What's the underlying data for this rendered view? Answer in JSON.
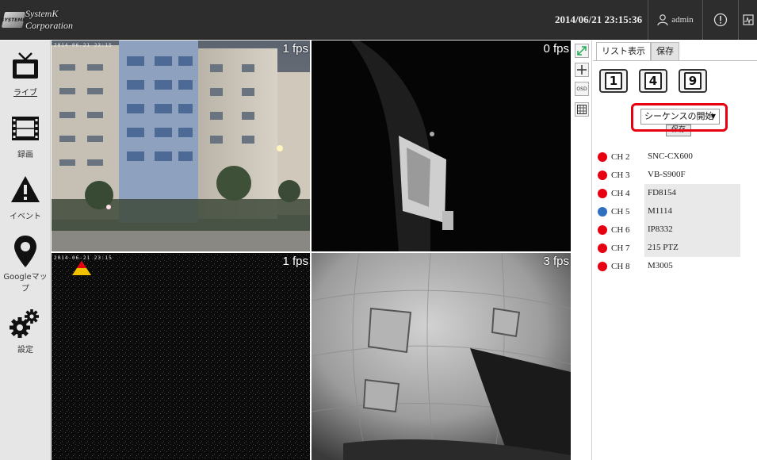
{
  "header": {
    "brand": "SystemK Corporation",
    "logo_mark": "SYSTEMK",
    "datetime": "2014/06/21 23:15:36",
    "user": "admin"
  },
  "sidebar": {
    "items": [
      {
        "label": "ライブ",
        "icon": "tv-icon"
      },
      {
        "label": "録画",
        "icon": "film-icon"
      },
      {
        "label": "イベント",
        "icon": "warning-icon"
      },
      {
        "label": "Googleマップ",
        "icon": "map-pin-icon"
      },
      {
        "label": "設定",
        "icon": "gears-icon"
      }
    ]
  },
  "cameras": [
    {
      "fps": "1 fps",
      "timestamp": "2014-06-21 23:15"
    },
    {
      "fps": "0 fps"
    },
    {
      "fps": "1 fps",
      "timestamp": "2014-06-21 23:15"
    },
    {
      "fps": "3 fps"
    }
  ],
  "tools": {
    "osd": "OSD"
  },
  "panel": {
    "tabs": [
      "リスト表示",
      "保存"
    ],
    "layouts": [
      "1",
      "4",
      "9"
    ],
    "sequence_select": "シーケンスの開始",
    "save_button": "保存",
    "channels": [
      {
        "ch": "CH 2",
        "name": "SNC-CX600",
        "status_color": "#e60012"
      },
      {
        "ch": "CH 3",
        "name": "VB-S900F",
        "status_color": "#e60012"
      },
      {
        "ch": "CH 4",
        "name": "FD8154",
        "status_color": "#e60012"
      },
      {
        "ch": "CH 5",
        "name": "M1114",
        "status_color": "#2f6fc0"
      },
      {
        "ch": "CH 6",
        "name": "IP8332",
        "status_color": "#e60012"
      },
      {
        "ch": "CH 7",
        "name": "215 PTZ",
        "status_color": "#e60012"
      },
      {
        "ch": "CH 8",
        "name": "M3005",
        "status_color": "#e60012"
      }
    ]
  },
  "colors": {
    "topbar": "#2d2d2d",
    "highlight": "#e60012",
    "online": "#e60012",
    "alt_status": "#2f6fc0"
  }
}
